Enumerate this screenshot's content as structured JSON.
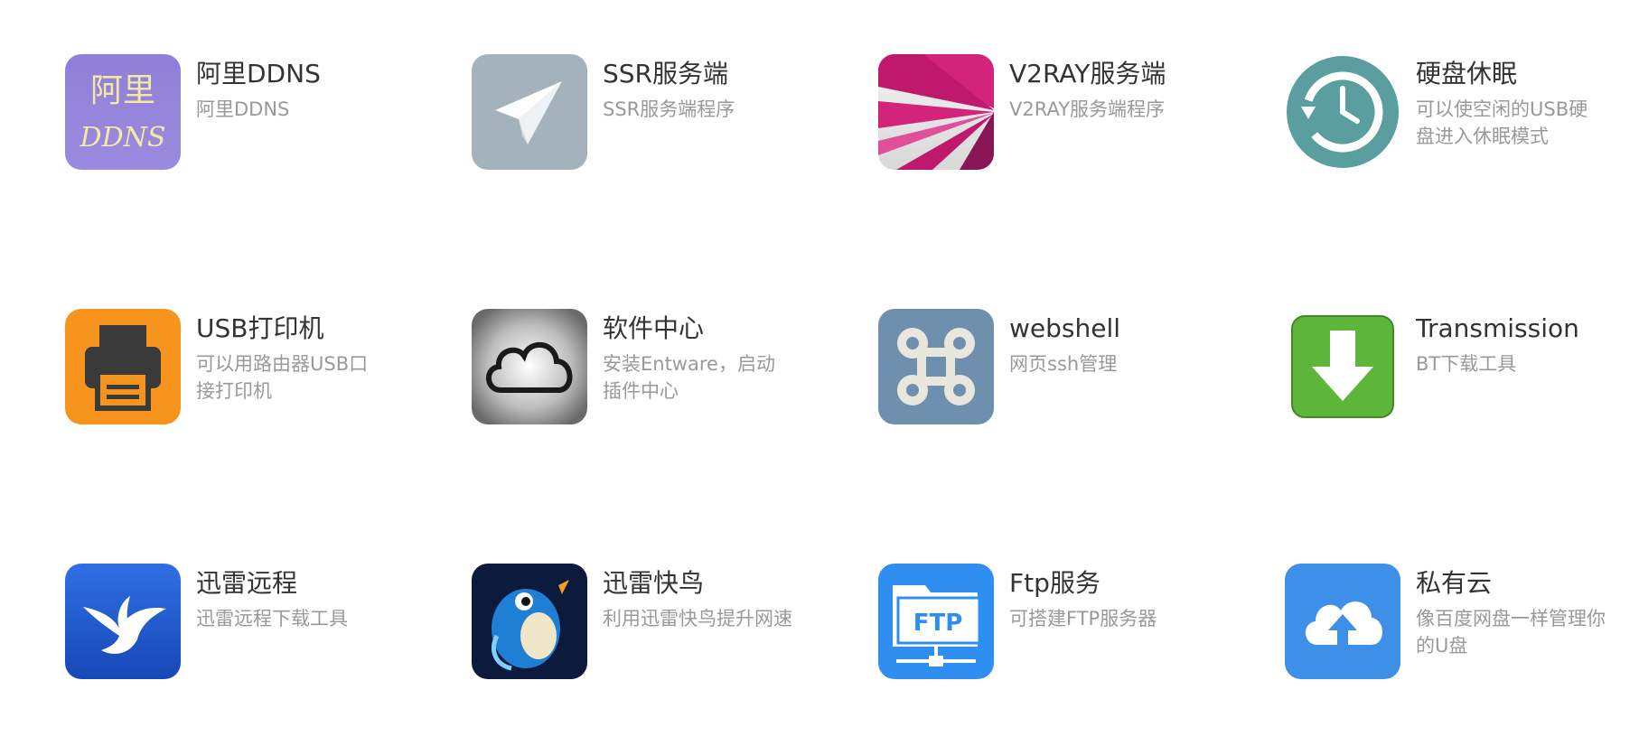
{
  "apps": [
    {
      "title": "阿里DDNS",
      "desc": "阿里DDNS",
      "icon": "aliddns-icon",
      "icon_text_top": "阿里",
      "icon_text_bottom": "DDNS"
    },
    {
      "title": "SSR服务端",
      "desc": "SSR服务端程序",
      "icon": "paper-plane-icon"
    },
    {
      "title": "V2RAY服务端",
      "desc": "V2RAY服务端程序",
      "icon": "v2ray-icon"
    },
    {
      "title": "硬盘休眠",
      "desc": "可以使空闲的USB硬盘进入休眠模式",
      "icon": "time-machine-icon"
    },
    {
      "title": "USB打印机",
      "desc": "可以用路由器USB口接打印机",
      "icon": "printer-icon"
    },
    {
      "title": "软件中心",
      "desc": "安装Entware，启动插件中心",
      "icon": "cloud-icon"
    },
    {
      "title": "webshell",
      "desc": "网页ssh管理",
      "icon": "command-key-icon"
    },
    {
      "title": "Transmission",
      "desc": "BT下载工具",
      "icon": "download-arrow-icon"
    },
    {
      "title": "迅雷远程",
      "desc": "迅雷远程下载工具",
      "icon": "hummingbird-icon"
    },
    {
      "title": "迅雷快鸟",
      "desc": "利用迅雷快鸟提升网速",
      "icon": "bird-icon"
    },
    {
      "title": "Ftp服务",
      "desc": "可搭建FTP服务器",
      "icon": "ftp-folder-icon",
      "icon_text": "FTP"
    },
    {
      "title": "私有云",
      "desc": "像百度网盘一样管理你的U盘",
      "icon": "cloud-upload-icon"
    }
  ]
}
